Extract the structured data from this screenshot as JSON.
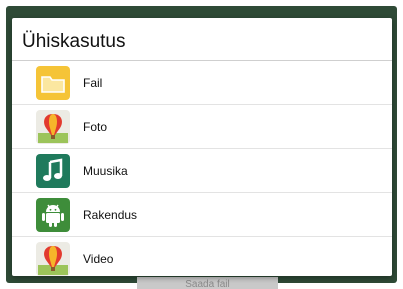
{
  "dialog": {
    "title": "Ühiskasutus",
    "items": [
      {
        "label": "Fail",
        "icon": "folder-icon"
      },
      {
        "label": "Foto",
        "icon": "photo-balloon-icon"
      },
      {
        "label": "Muusika",
        "icon": "music-note-icon"
      },
      {
        "label": "Rakendus",
        "icon": "android-icon"
      },
      {
        "label": "Video",
        "icon": "video-balloon-icon"
      }
    ]
  },
  "background": {
    "send_button_label": "Saada fail"
  },
  "colors": {
    "frame_bg": "#2e4a36",
    "file_icon": "#f5c437",
    "music_icon": "#1f7a5c",
    "app_icon": "#3e8d3a"
  }
}
